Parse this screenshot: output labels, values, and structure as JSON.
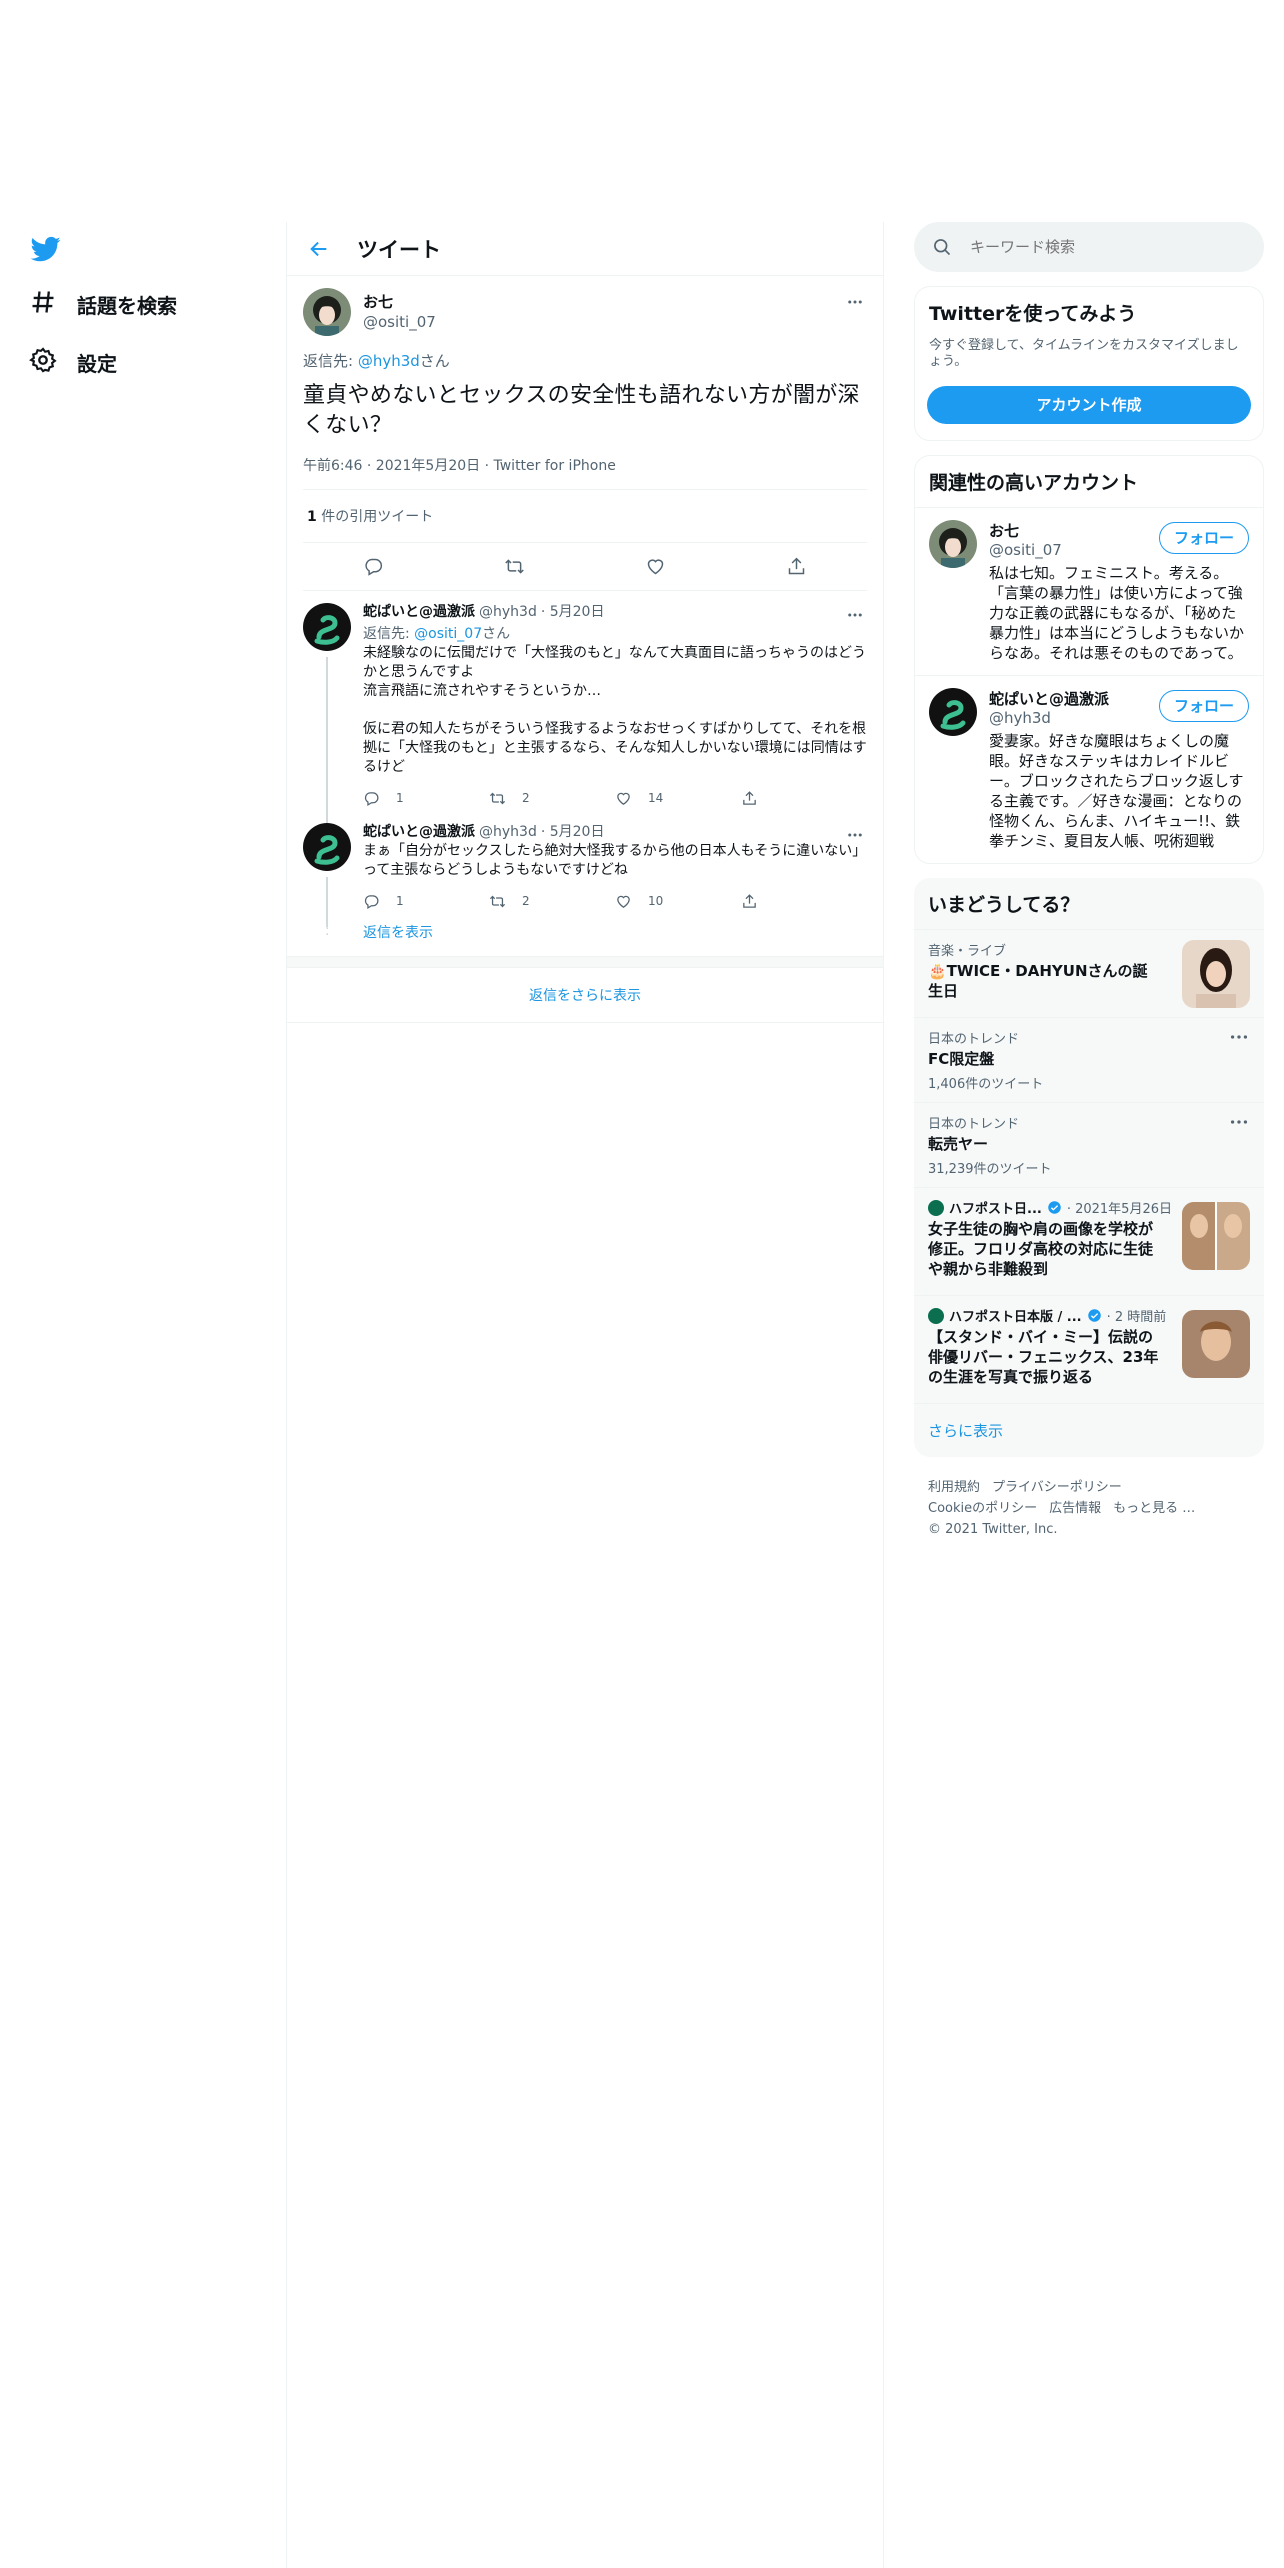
{
  "colors": {
    "accent": "#1d9bf0",
    "link": "#1b95e0",
    "text": "#0f1419",
    "muted": "#536471"
  },
  "sidebar": {
    "logo": "twitter-bird-icon",
    "items": [
      {
        "label": "話題を検索",
        "icon": "hashtag-icon"
      },
      {
        "label": "設定",
        "icon": "gear-icon"
      }
    ]
  },
  "header": {
    "title": "ツイート"
  },
  "focused_tweet": {
    "name": "お七",
    "handle": "@ositi_07",
    "reply_prefix": "返信先: ",
    "reply_handle": "@hyh3d",
    "reply_suffix": "さん",
    "text": "童貞やめないとセックスの安全性も語れない方が闇が深くない？",
    "meta": "午前6:46 · 2021年5月20日 · Twitter for iPhone",
    "quote_count": "1",
    "quote_label": " 件の引用ツイート"
  },
  "replies": [
    {
      "name": "蛇ぱいと@過激派",
      "handle": "@hyh3d",
      "date": "· 5月20日",
      "reply_prefix": "返信先: ",
      "reply_handle": "@ositi_07",
      "reply_suffix": "さん",
      "text": "未経験なのに伝聞だけで「大怪我のもと」なんて大真面目に語っちゃうのはどうかと思うんですよ\n流言飛語に流されやすそうというか…\n\n仮に君の知人たちがそういう怪我するようなおせっくすばかりしてて、それを根拠に「大怪我のもと」と主張するなら、そんな知人しかいない環境には同情はするけど",
      "replies": "1",
      "retweets": "2",
      "likes": "14"
    },
    {
      "name": "蛇ぱいと@過激派",
      "handle": "@hyh3d",
      "date": "· 5月20日",
      "text": "まぁ「自分がセックスしたら絶対大怪我するから他の日本人もそうに違いない」って主張ならどうしようもないですけどね",
      "replies": "1",
      "retweets": "2",
      "likes": "10"
    }
  ],
  "show_replies": "返信を表示",
  "more_replies": "返信をさらに表示",
  "search": {
    "placeholder": "キーワード検索"
  },
  "signup": {
    "title": "Twitterを使ってみよう",
    "subtitle": "今すぐ登録して、タイムラインをカスタマイズしましょう。",
    "button": "アカウント作成"
  },
  "related": {
    "title": "関連性の高いアカウント",
    "accounts": [
      {
        "name": "お七",
        "handle": "@ositi_07",
        "follow": "フォロー",
        "bio": "私は七知。フェミニスト。考える。「言葉の暴力性」は使い方によって強力な正義の武器にもなるが、「秘めた暴力性」は本当にどうしようもないからなあ。それは悪そのものであって。"
      },
      {
        "name": "蛇ぱいと@過激派",
        "handle": "@hyh3d",
        "follow": "フォロー",
        "bio": "愛妻家。好きな魔眼はちょくしの魔眼。好きなステッキはカレイドルビー。ブロックされたらブロック返しする主義です。／好きな漫画：となりの怪物くん、らんま、ハイキュー!!、鉄拳チンミ、夏目友人帳、呪術廻戦"
      }
    ]
  },
  "trends": {
    "title": "いまどうしてる？",
    "items": [
      {
        "category": "音楽・ライブ",
        "title": "🎂TWICE・DAHYUNさんの誕生日"
      },
      {
        "category": "日本のトレンド",
        "title": "FC限定盤",
        "count": "1,406件のツイート"
      },
      {
        "category": "日本のトレンド",
        "title": "転売ヤー",
        "count": "31,239件のツイート"
      }
    ],
    "news": [
      {
        "source": "ハフポスト日...",
        "time": "· 2021年5月26日",
        "title": "女子生徒の胸や肩の画像を学校が修正。フロリダ高校の対応に生徒や親から非難殺到"
      },
      {
        "source": "ハフポスト日本版 / ...",
        "time": "· 2 時間前",
        "title": "【スタンド・バイ・ミー】伝説の俳優リバー・フェニックス、23年の生涯を写真で振り返る"
      }
    ],
    "show_more": "さらに表示"
  },
  "footer": {
    "links": [
      "利用規約",
      "プライバシーポリシー",
      "Cookieのポリシー",
      "広告情報",
      "もっと見る …"
    ],
    "copyright": "© 2021 Twitter, Inc."
  }
}
